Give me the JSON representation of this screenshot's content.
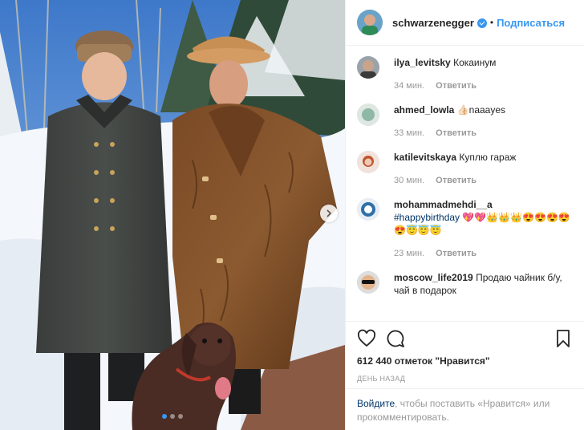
{
  "post": {
    "author": "schwarzenegger",
    "separator": "•",
    "follow_label": "Подписаться",
    "likes_text": "612 440 отметок \"Нравится\"",
    "date_text": "День назад",
    "login_link": "Войдите",
    "login_text": ", чтобы поставить «Нравится» или прокомментировать.",
    "carousel": {
      "slides": 3,
      "active": 1
    }
  },
  "comments": [
    {
      "user": "ilya_levitsky",
      "text": "Кокаинум",
      "time": "34 мин.",
      "reply": "Ответить"
    },
    {
      "user": "ahmed_lowla",
      "text": "👍🏻naaayes",
      "time": "33 мин.",
      "reply": "Ответить"
    },
    {
      "user": "katilevitskaya",
      "text": "Куплю гараж",
      "time": "30 мин.",
      "reply": "Ответить"
    },
    {
      "user": "mohammadmehdi__a",
      "tag": "#happybirthday",
      "text": " 💖💖👑👑👑😍😍😍😍😍😇😇😇",
      "time": "23 мин.",
      "reply": "Ответить"
    },
    {
      "user": "moscow_life2019",
      "text": "Продаю чайник б/у, чай в подарок",
      "time": "",
      "reply": ""
    }
  ],
  "colors": {
    "accent": "#3897f0",
    "link": "#003569",
    "muted": "#999999",
    "text": "#262626"
  },
  "icons": [
    "heart-icon",
    "comment-icon",
    "bookmark-icon",
    "chevron-right-icon",
    "verified-badge-icon"
  ]
}
